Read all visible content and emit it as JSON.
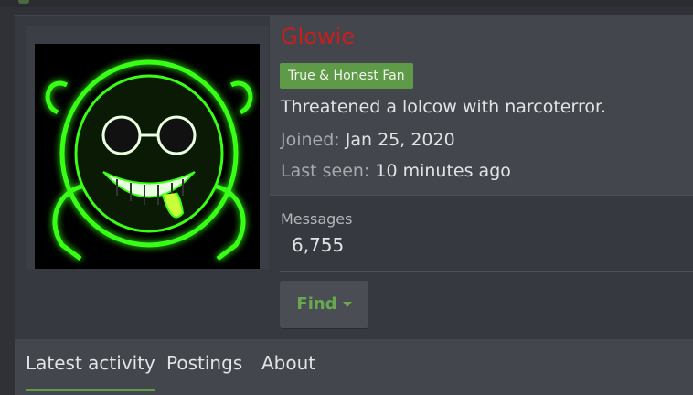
{
  "profile": {
    "username": "Glowie",
    "badge": "True & Honest Fan",
    "bio": "Threatened a lolcow with narcoterror.",
    "joined_label": "Joined:",
    "joined_value": "Jan 25, 2020",
    "last_seen_label": "Last seen:",
    "last_seen_value": "10 minutes ago"
  },
  "stats": {
    "messages_label": "Messages",
    "messages_value": "6,755"
  },
  "actions": {
    "find_label": "Find"
  },
  "tabs": [
    {
      "label": "Latest activity",
      "active": true
    },
    {
      "label": "Postings",
      "active": false
    },
    {
      "label": "About",
      "active": false
    }
  ],
  "colors": {
    "username": "#c81e1e",
    "accent": "#5f9a49",
    "avatar_glow": "#39ff14"
  }
}
